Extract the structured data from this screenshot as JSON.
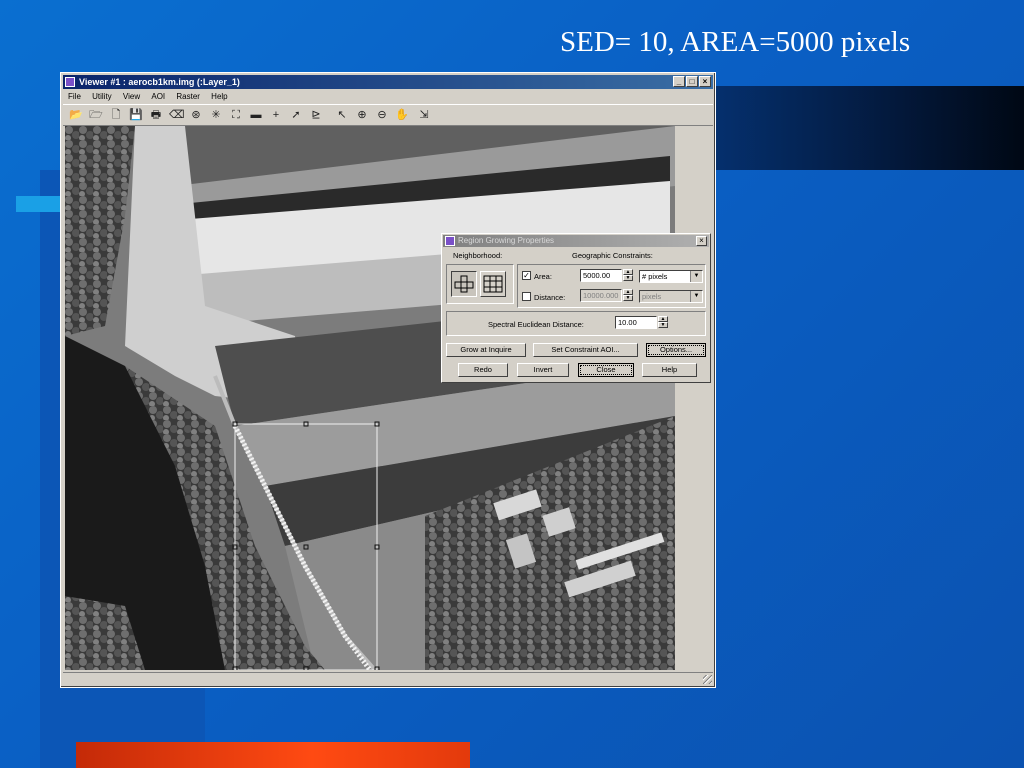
{
  "slide": {
    "title": "SED= 10, AREA=5000 pixels",
    "colors": {
      "background": "#0a62c8",
      "accent_cyan": "#1aa0e6",
      "accent_orange": "#ff4a12"
    }
  },
  "viewer": {
    "title": "Viewer #1 : aerocb1km.img (:Layer_1)",
    "window_buttons": [
      "_",
      "□",
      "×"
    ],
    "menu": [
      "File",
      "Utility",
      "View",
      "AOI",
      "Raster",
      "Help"
    ],
    "toolbar_icons": [
      "open-folder-icon",
      "new-folder-icon",
      "new-document-icon",
      "save-icon",
      "print-icon",
      "eraser-icon",
      "clear-icon",
      "fit-icon",
      "reset-icon",
      "measure-icon",
      "crosshair-icon",
      "pointer-arrow-icon",
      "inquire-icon",
      "select-arrow-icon",
      "zoom-in-icon",
      "zoom-out-icon",
      "pan-hand-icon",
      "region-grow-icon"
    ],
    "toolbar_glyphs": [
      "📂",
      "🗁",
      "🗋",
      "💾",
      "🖶",
      "⌫",
      "⊛",
      "✳",
      "⛶",
      "▬",
      "+",
      "➚",
      "⊵",
      "↖",
      "⊕",
      "⊖",
      "✋",
      "⇲"
    ]
  },
  "dialog": {
    "title": "Region Growing Properties",
    "neighborhood_label": "Neighborhood:",
    "geo_constraints_label": "Geographic Constraints:",
    "area": {
      "label": "Area:",
      "checked": true,
      "value": "5000.00",
      "unit": "# pixels"
    },
    "distance": {
      "label": "Distance:",
      "checked": false,
      "value": "10000.000",
      "unit": "pixels"
    },
    "sed": {
      "label": "Spectral Euclidean Distance:",
      "value": "10.00"
    },
    "buttons": {
      "grow": "Grow at Inquire",
      "constraint": "Set Constraint AOI...",
      "options": "Options...",
      "redo": "Redo",
      "invert": "Invert",
      "close": "Close",
      "help": "Help"
    }
  }
}
